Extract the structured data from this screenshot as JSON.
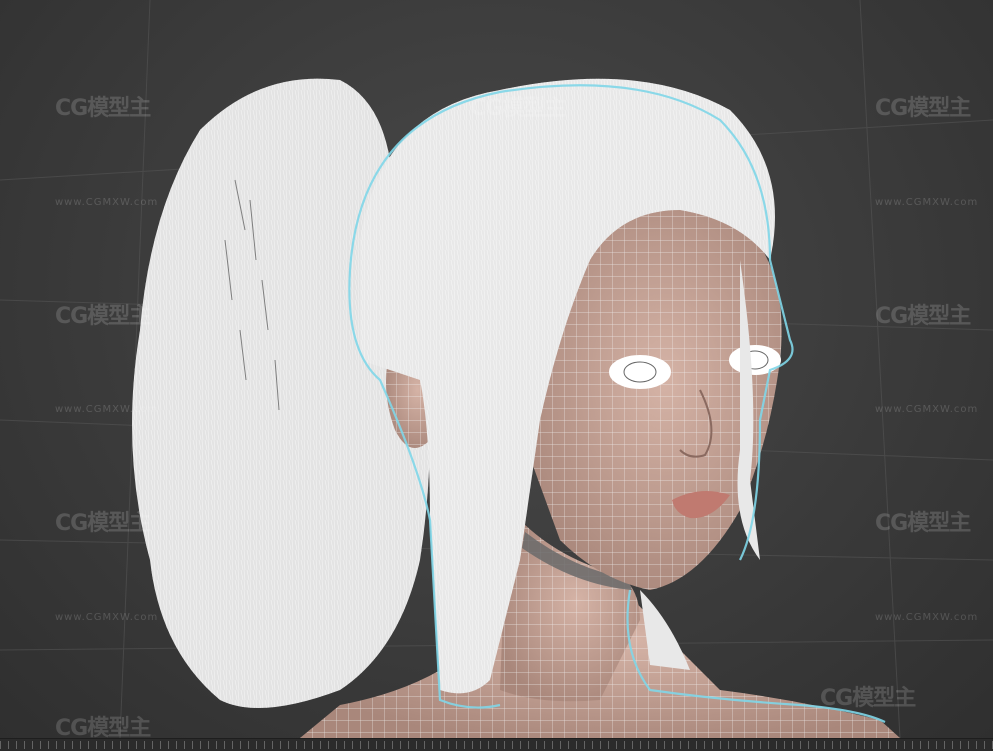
{
  "viewport": {
    "name": "3D perspective viewport",
    "colors": {
      "background": "#3b3b3b",
      "hair": "#e6e6e6",
      "skin": "#c9a396",
      "selection_outline": "#7fd6e8",
      "wire": "#f4f4f4"
    }
  },
  "watermark": {
    "logo_text": "CG模型主",
    "url_text": "www.CGMXW.com",
    "url_text_short": "www.CGMXW.com"
  },
  "timeline": {
    "icon": "timeline-ruler"
  }
}
